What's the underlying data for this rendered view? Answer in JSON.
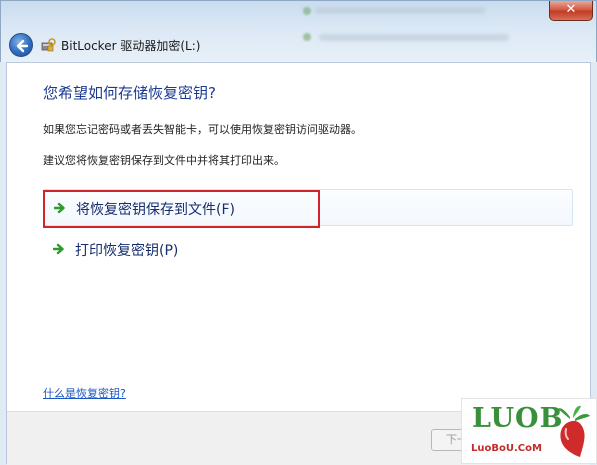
{
  "window": {
    "title": "BitLocker 驱动器加密(L:)",
    "close_label": "✕"
  },
  "page": {
    "heading": "您希望如何存储恢复密钥?",
    "description": "如果您忘记密码或者丢失智能卡，可以使用恢复密钥访问驱动器。",
    "suggestion": "建议您将恢复密钥保存到文件中并将其打印出来。"
  },
  "options": [
    {
      "label": "将恢复密钥保存到文件(F)",
      "highlighted": true
    },
    {
      "label": "打印恢复密钥(P)",
      "highlighted": false
    }
  ],
  "help_link": "什么是恢复密钥?",
  "footer": {
    "next_label": "下一"
  },
  "watermark": {
    "logo": "LUOB",
    "url": "LuoBoU.CoM"
  },
  "colors": {
    "heading": "#1c3b8f",
    "link": "#1a55c4",
    "arrow": "#2c9a2c",
    "highlight_box": "#d0242a"
  }
}
